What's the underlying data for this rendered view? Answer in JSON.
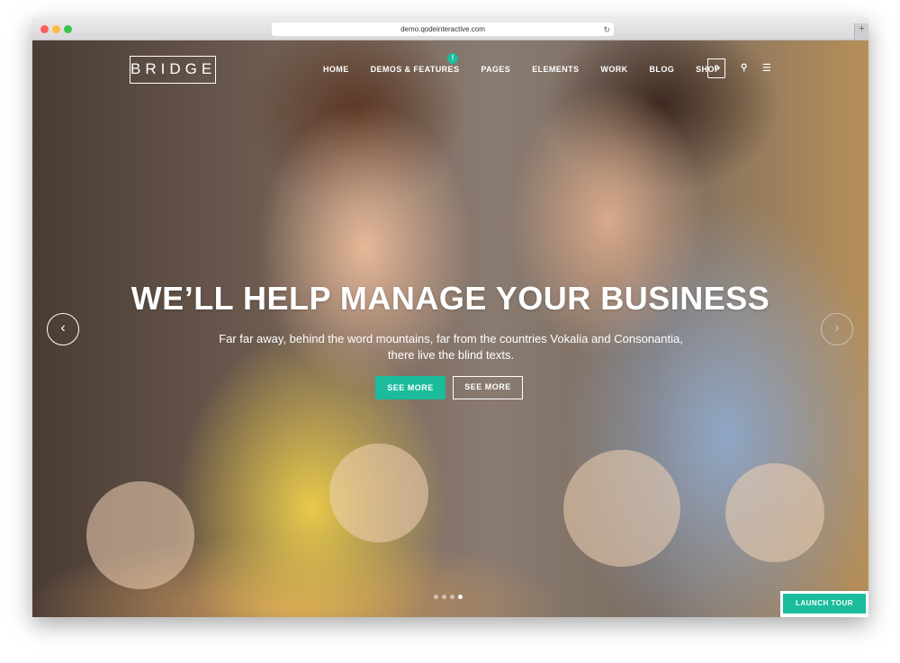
{
  "browser": {
    "url": "demo.qodeinteractive.com",
    "colors": {
      "close": "#fc605c",
      "minimize": "#fdbc40",
      "maximize": "#34c84a"
    }
  },
  "header": {
    "logo": "BRIDGE",
    "nav": [
      "HOME",
      "DEMOS & FEATURES",
      "PAGES",
      "ELEMENTS",
      "WORK",
      "BLOG",
      "SHOP"
    ],
    "badge": "!",
    "cart_count": "0"
  },
  "slider": {
    "title": "WE’LL HELP MANAGE YOUR BUSINESS",
    "subtitle_line1": "Far far away, behind the word mountains, far from the countries Vokalia and Consonantia,",
    "subtitle_line2": "there live the blind texts.",
    "button1": "SEE MORE",
    "button2": "SEE MORE",
    "prev_icon": "chevron-left",
    "next_icon": "chevron-right",
    "slide_count": 4,
    "active_slide": 4
  },
  "launch_tour": "LAUNCH TOUR",
  "accent": "#1abc9c"
}
